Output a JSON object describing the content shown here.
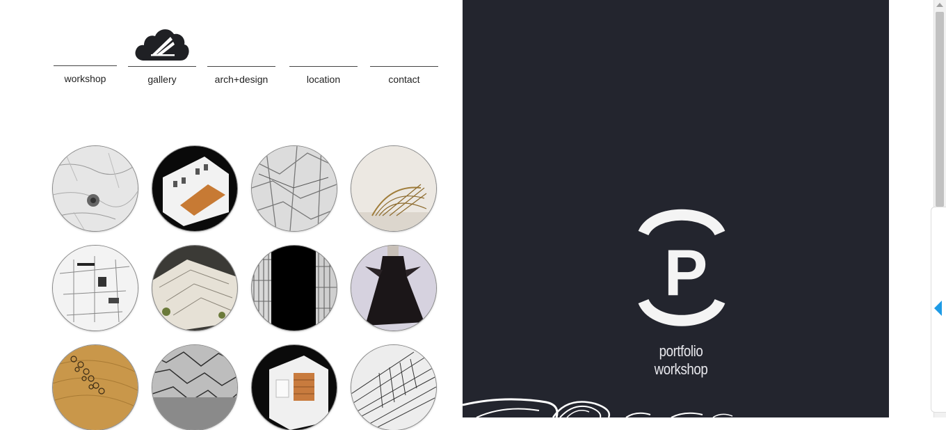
{
  "nav": {
    "items": [
      {
        "label": "workshop"
      },
      {
        "label": "gallery"
      },
      {
        "label": "arch+design"
      },
      {
        "label": "location"
      },
      {
        "label": "contact"
      }
    ]
  },
  "gallery": {
    "thumbnails": [
      {
        "subject": "textured-paper-relief"
      },
      {
        "subject": "white-building-model-orange"
      },
      {
        "subject": "carved-texture-sketch"
      },
      {
        "subject": "wire-sculpture"
      },
      {
        "subject": "architectural-sketch-model"
      },
      {
        "subject": "paper-building-model"
      },
      {
        "subject": "tower-structures-dark"
      },
      {
        "subject": "black-dress-sculpture"
      },
      {
        "subject": "cork-topography-model"
      },
      {
        "subject": "crumpled-texture"
      },
      {
        "subject": "cube-building-model"
      },
      {
        "subject": "fan-sculpture-drawing"
      }
    ]
  },
  "brand": {
    "letter": "P",
    "tagline_line1": "portfolio",
    "tagline_line2": "workshop"
  },
  "colors": {
    "dark_panel": "#23252e",
    "accent_arrow": "#1e9be6",
    "text_dark": "#222222",
    "text_light": "#e9e9ee"
  }
}
